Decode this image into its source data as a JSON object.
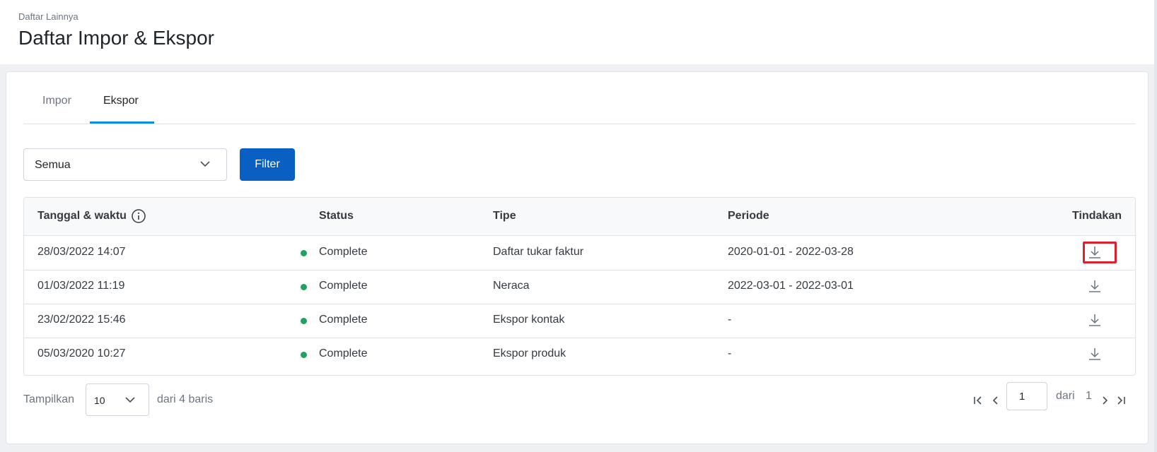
{
  "header": {
    "breadcrumb": "Daftar Lainnya",
    "title": "Daftar Impor & Ekspor"
  },
  "tabs": [
    {
      "label": "Impor",
      "active": false
    },
    {
      "label": "Ekspor",
      "active": true
    }
  ],
  "filter": {
    "select_value": "Semua",
    "button_label": "Filter"
  },
  "table": {
    "columns": [
      "Tanggal & waktu",
      "Status",
      "Tipe",
      "Periode",
      "Tindakan"
    ],
    "rows": [
      {
        "datetime": "28/03/2022 14:07",
        "status": "Complete",
        "type": "Daftar tukar faktur",
        "period": "2020-01-01 - 2022-03-28"
      },
      {
        "datetime": "01/03/2022 11:19",
        "status": "Complete",
        "type": "Neraca",
        "period": "2022-03-01 - 2022-03-01"
      },
      {
        "datetime": "23/02/2022 15:46",
        "status": "Complete",
        "type": "Ekspor kontak",
        "period": "-"
      },
      {
        "datetime": "05/03/2020 10:27",
        "status": "Complete",
        "type": "Ekspor produk",
        "period": "-"
      }
    ]
  },
  "pagination": {
    "show_label": "Tampilkan",
    "page_size": "10",
    "rows_text": "dari 4 baris",
    "current_page": "1",
    "of_label": "dari",
    "total_pages": "1"
  },
  "colors": {
    "accent": "#0a5fc2",
    "tab_indicator": "#0d8de0",
    "status_complete": "#1aa260",
    "highlight": "#e01e2d"
  },
  "icons": {
    "select_chevron": "chevron-down-icon",
    "info": "info-icon",
    "download": "download-icon",
    "first_page": "first-page-icon",
    "prev_page": "prev-page-icon",
    "next_page": "next-page-icon",
    "last_page": "last-page-icon"
  }
}
